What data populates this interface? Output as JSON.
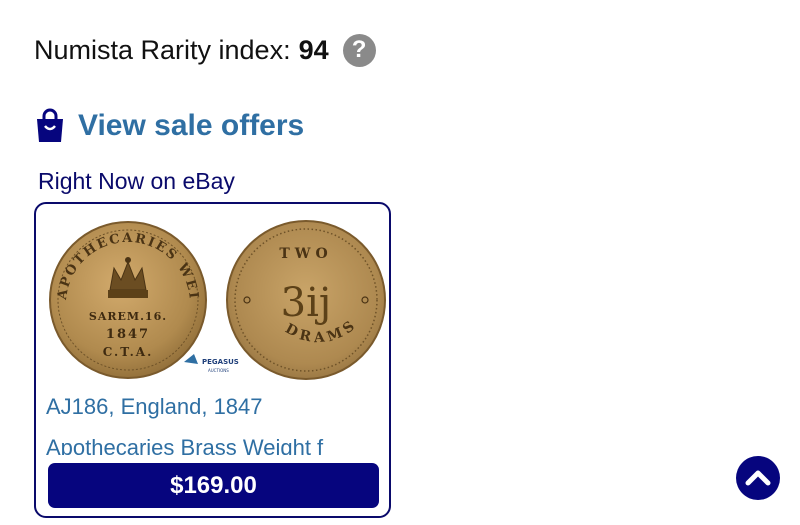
{
  "rarity": {
    "label": "Numista Rarity index:",
    "value": "94",
    "help_icon": "question-circle-icon"
  },
  "sale": {
    "icon": "shopping-bag-icon",
    "link_label": "View sale offers"
  },
  "ebay": {
    "heading": "Right Now on eBay",
    "item": {
      "title": "AJ186, England, 1847",
      "subtitle": "Apothecaries Brass Weight f",
      "price": "$169.00",
      "image_text": {
        "obverse_ring": "APOTHECARIES WEIGHT",
        "obverse_center": "SAREM.16.",
        "obverse_year": "1847",
        "obverse_mark": "C.T.A.",
        "reverse_top": "TWO",
        "reverse_center": "3ij",
        "reverse_bottom": "DRAMS",
        "watermark": "PEGASUS",
        "watermark_sub": "AUCTIONS"
      }
    }
  },
  "scroll_top": {
    "icon": "chevron-up-icon"
  },
  "colors": {
    "navy": "#06057e",
    "link_blue": "#2f6fa3",
    "help_gray": "#8a8a8a",
    "coin_brass": "#b08a4e"
  }
}
